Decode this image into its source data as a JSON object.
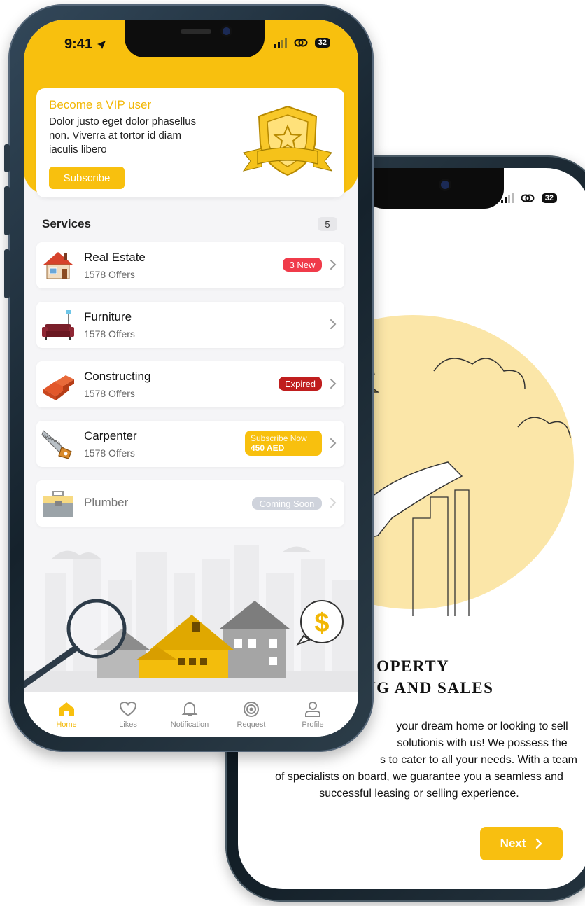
{
  "colors": {
    "accent": "#f8c00e",
    "new_tag": "#f03b4a",
    "expired_tag": "#c01e1e",
    "coming_soon": "#cfd3dc"
  },
  "back_phone": {
    "status": {
      "signal": "signal-icon",
      "link": "link-icon",
      "battery": "32"
    },
    "title_line1": "ROPERTY",
    "title_line2": "NG AND SALES",
    "description": "your dream home or looking to sell solutionis with us! We possess the  s to cater to all your needs. With a team of specialists on board, we guarantee you a seamless and successful leasing or selling experience.",
    "desc_line1": "your dream home or looking to sell",
    "desc_line2": "solutionis with us! We possess the",
    "desc_line3": "s to cater to all your needs. With a team",
    "desc_line4": "of specialists on board, we guarantee you a seamless and",
    "desc_line5": "successful leasing or selling experience.",
    "next_label": "Next"
  },
  "front_phone": {
    "status": {
      "time": "9:41",
      "battery": "32"
    },
    "vip": {
      "title": "Become a VIP user",
      "desc_line1": "Dolor justo eget dolor phasellus",
      "desc_line2": "non. Viverra at tortor id diam",
      "desc_line3": "iaculis libero",
      "subscribe_label": "Subscribe"
    },
    "services": {
      "label": "Services",
      "count": "5",
      "items": [
        {
          "name": "Real Estate",
          "offers": "1578 Offers",
          "tag": "3 New",
          "icon": "house-icon"
        },
        {
          "name": "Furniture",
          "offers": "1578 Offers",
          "tag": "",
          "icon": "sofa-icon"
        },
        {
          "name": "Constructing",
          "offers": "1578 Offers",
          "tag": "Expired",
          "icon": "bricks-icon"
        },
        {
          "name": "Carpenter",
          "offers": "1578 Offers",
          "tag_line1": "Subscribe Now",
          "tag_line2": "450 AED",
          "icon": "saw-icon"
        },
        {
          "name": "Plumber",
          "offers": "",
          "tag": "Coming Soon",
          "icon": "toolbox-icon"
        }
      ]
    },
    "tabs": [
      {
        "label": "Home",
        "icon": "home-icon",
        "active": true
      },
      {
        "label": "Likes",
        "icon": "heart-icon",
        "active": false
      },
      {
        "label": "Notification",
        "icon": "bell-icon",
        "active": false
      },
      {
        "label": "Request",
        "icon": "target-icon",
        "active": false
      },
      {
        "label": "Profile",
        "icon": "user-icon",
        "active": false
      }
    ]
  }
}
